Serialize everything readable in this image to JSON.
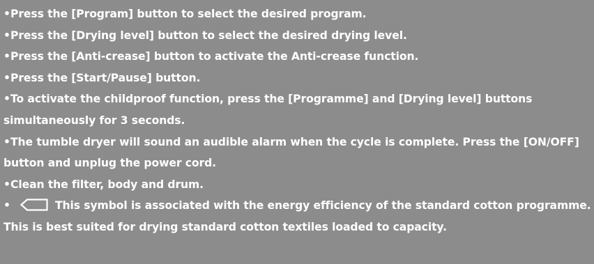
{
  "bullet": "•",
  "instructions": [
    "Press the [Program] button to select the desired program.",
    "Press the [Drying level] button to select the desired drying level.",
    "Press the [Anti-crease] button to activate the Anti-crease function.",
    "Press the [Start/Pause] button.",
    "To activate the childproof function, press the [Programme] and [Drying level] buttons simultaneously for 3 seconds.",
    "The tumble dryer will sound an audible alarm when the cycle is complete. Press the [ON/OFF] button and unplug the power cord.",
    "Clean the filter, body and drum.",
    "This symbol is associated with the energy efficiency of the standard cotton programme. This is best suited for drying standard cotton textiles loaded to capacity."
  ],
  "symbol": {
    "icon": "standard-cotton-programme-icon",
    "color": "#ffffff"
  },
  "colors": {
    "background": "#8c8c8c",
    "text": "#ffffff"
  }
}
